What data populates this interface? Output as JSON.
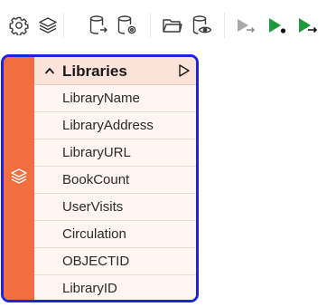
{
  "toolbar": {
    "buttons": [
      {
        "icon": "gear-icon"
      },
      {
        "icon": "layers-icon"
      },
      {
        "icon": "database-export-icon"
      },
      {
        "icon": "database-settings-icon"
      },
      {
        "icon": "folder-open-icon"
      },
      {
        "icon": "database-view-icon"
      },
      {
        "icon": "run-disabled-icon"
      },
      {
        "icon": "run-icon"
      },
      {
        "icon": "run-all-icon"
      }
    ],
    "colors": {
      "icon": "#3a3a3a",
      "run_green": "#1f9a3a",
      "run_disabled": "#a9a9a9"
    }
  },
  "table": {
    "title": "Libraries",
    "fields": [
      "LibraryName",
      "LibraryAddress",
      "LibraryURL",
      "BookCount",
      "UserVisits",
      "Circulation",
      "OBJECTID",
      "LibraryID"
    ],
    "colors": {
      "border": "#1d24e0",
      "strip": "#f26d3f",
      "header_bg": "#fce3d9",
      "row_bg": "#fff5f1"
    }
  }
}
